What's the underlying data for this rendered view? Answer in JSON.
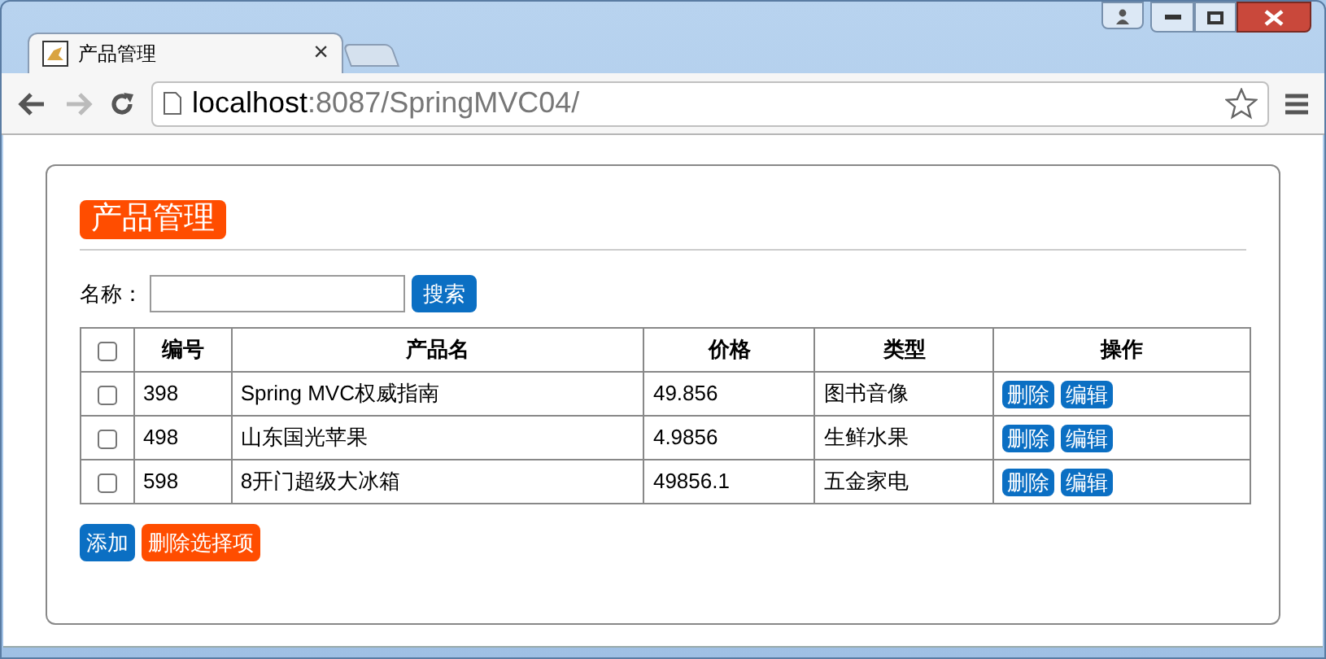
{
  "browser": {
    "tab": {
      "title": "产品管理",
      "close": "×"
    },
    "address": {
      "host": "localhost",
      "path": ":8087/SpringMVC04/"
    }
  },
  "page": {
    "title": "产品管理",
    "search": {
      "label": "名称：",
      "button": "搜索"
    },
    "table": {
      "header_checked": false,
      "columns": [
        "编号",
        "产品名",
        "价格",
        "类型",
        "操作"
      ],
      "rows": [
        {
          "checked": false,
          "cells": [
            "398",
            "Spring MVC权威指南",
            "49.856",
            "图书音像"
          ],
          "actions": [
            "删除",
            "编辑"
          ]
        },
        {
          "checked": false,
          "cells": [
            "498",
            "山东国光苹果",
            "4.9856",
            "生鲜水果"
          ],
          "actions": [
            "删除",
            "编辑"
          ]
        },
        {
          "checked": false,
          "cells": [
            "598",
            "8开门超级大冰箱",
            "49856.1",
            "五金家电"
          ],
          "actions": [
            "删除",
            "编辑"
          ]
        }
      ]
    },
    "buttons": [
      {
        "label": "添加",
        "kind": "primary"
      },
      {
        "label": "删除选择项",
        "kind": "danger"
      }
    ]
  }
}
